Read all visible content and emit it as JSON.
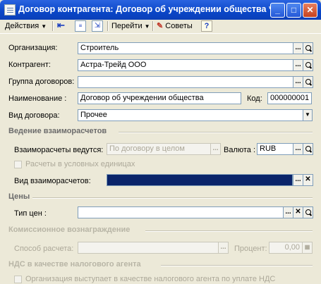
{
  "window": {
    "title": "Договор контрагента: Договор об учреждении общества *",
    "minimize": "_",
    "maximize": "□",
    "close": "✕"
  },
  "toolbar": {
    "actions": "Действия",
    "goto": "Перейти",
    "tips": "Советы",
    "help": "?"
  },
  "form": {
    "org_label": "Организация:",
    "org_value": "Строитель",
    "contr_label": "Контрагент:",
    "contr_value": "Астра-Трейд ООО",
    "group_label": "Группа договоров:",
    "group_value": "",
    "name_label": "Наименование :",
    "name_value": "Договор об учреждении общества",
    "code_label": "Код:",
    "code_value": "000000001",
    "kind_label": "Вид договора:",
    "kind_value": "Прочее"
  },
  "settlements": {
    "header": "Ведение взаиморасчетов",
    "conducted_label": "Взаиморасчеты ведутся:",
    "conducted_value": "По договору в целом",
    "currency_label": "Валюта :",
    "currency_value": "RUB",
    "cond_units_label": "Расчеты в условных единицах",
    "kind_label": "Вид взаиморасчетов:",
    "kind_value": ""
  },
  "prices": {
    "header": "Цены",
    "type_label": "Тип цен :",
    "type_value": ""
  },
  "commission": {
    "header": "Комиссионное вознаграждение",
    "method_label": "Способ расчета:",
    "method_value": "",
    "percent_label": "Процент:",
    "percent_value": "0,00"
  },
  "vat": {
    "header": "НДС в качестве налогового агента",
    "agent_label": "Организация выступает в качестве налогового агента по уплате НДС"
  },
  "colors": {
    "title_bar": "#0a46c8",
    "window_bg": "#ECE9D8",
    "selection": "#0a246a"
  },
  "buttons": {
    "select": "...",
    "clear": "✕"
  }
}
